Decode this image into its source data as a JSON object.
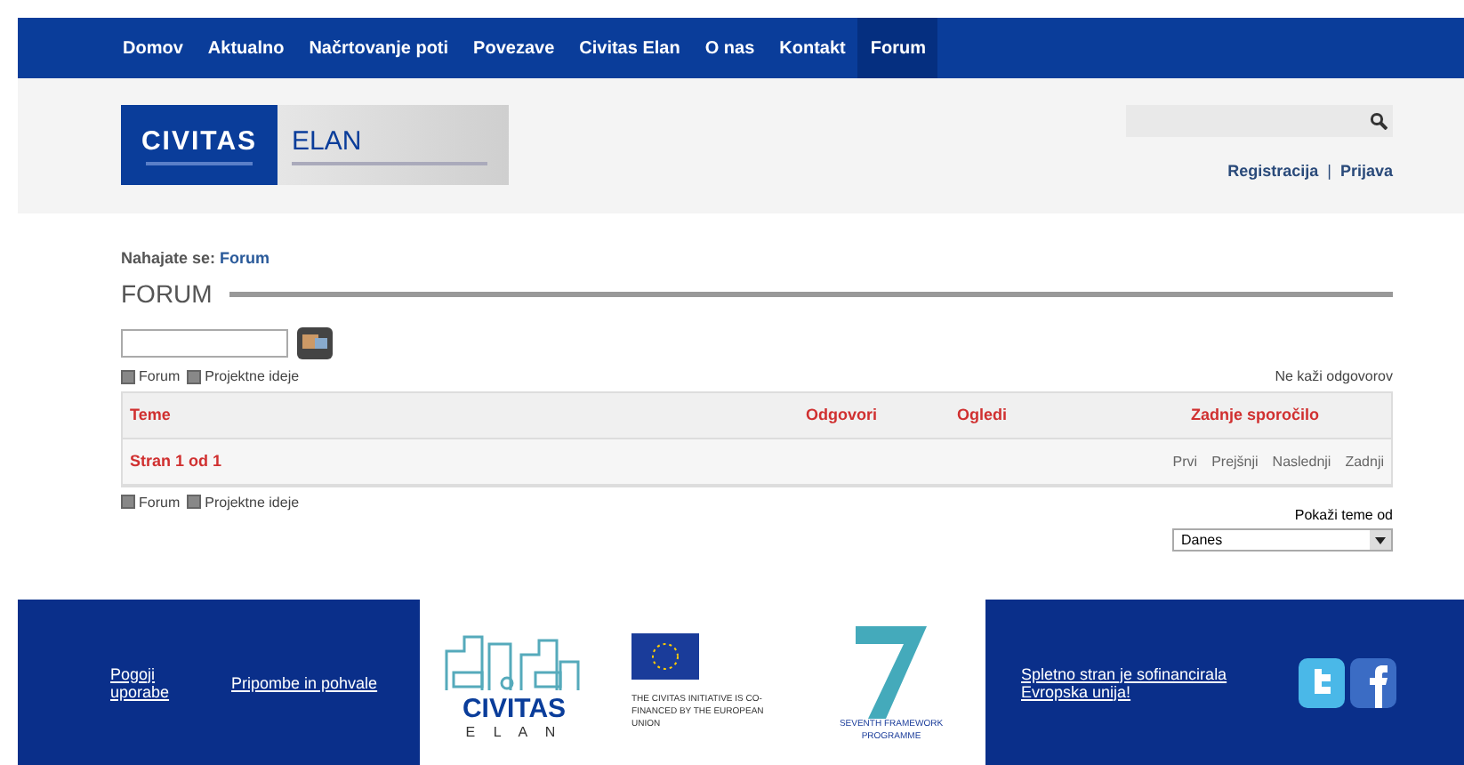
{
  "nav": {
    "items": [
      {
        "label": "Domov",
        "selected": false
      },
      {
        "label": "Aktualno",
        "selected": false
      },
      {
        "label": "Načrtovanje poti",
        "selected": false
      },
      {
        "label": "Povezave",
        "selected": false
      },
      {
        "label": "Civitas Elan",
        "selected": false
      },
      {
        "label": "O nas",
        "selected": false
      },
      {
        "label": "Kontakt",
        "selected": false
      },
      {
        "label": "Forum",
        "selected": true
      }
    ]
  },
  "header": {
    "logo": {
      "left": "CIVITAS",
      "right": "ELAN"
    },
    "links": [
      "Registracija",
      "Prijava"
    ],
    "separator": "|"
  },
  "breadcrumb": {
    "label": "Nahajate se:",
    "link": "Forum"
  },
  "title": "FORUM",
  "filters": [
    {
      "label": "Forum",
      "checked": true
    },
    {
      "label": "Projektne ideje",
      "checked": true
    }
  ],
  "hide_replies": "Ne kaži odgovorov",
  "table": {
    "columns": [
      "Teme",
      "Odgovori",
      "Ogledi",
      "Zadnje sporočilo"
    ],
    "page": "Stran 1 od 1",
    "pager": [
      "Prvi",
      "Prejšnji",
      "Naslednji",
      "Zadnji"
    ]
  },
  "filters_bottom": [
    {
      "label": "Forum",
      "checked": true
    },
    {
      "label": "Projektne ideje",
      "checked": true
    }
  ],
  "show_topics": {
    "label": "Pokaži teme od",
    "value": "Danes"
  },
  "footer": {
    "links_left": [
      "Pogoji uporabe",
      "Pripombe in pohvale"
    ],
    "civitas": {
      "name": "CIVITAS",
      "sub": "E L A N"
    },
    "eu_text": "THE CIVITAS INITIATIVE IS CO-FINANCED BY THE EUROPEAN UNION",
    "fp7_text": "SEVENTH FRAMEWORK PROGRAMME",
    "note": "Spletno stran je sofinancirala Evropska unija!"
  }
}
